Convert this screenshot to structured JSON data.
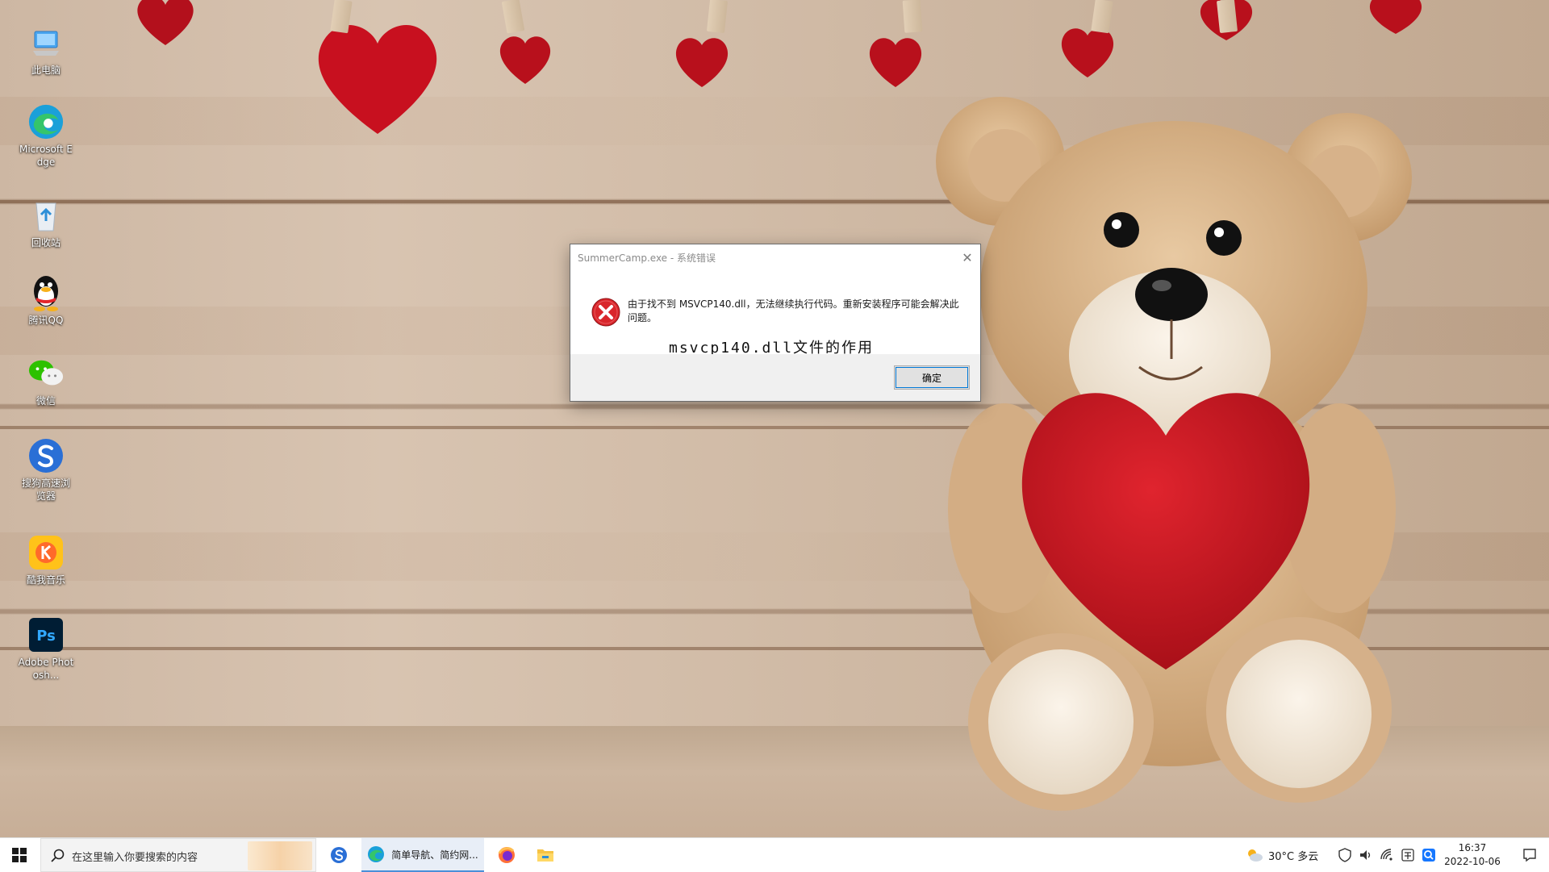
{
  "desktop": {
    "icons": [
      {
        "name": "this-pc",
        "label": "此电脑",
        "icon": "monitor-icon"
      },
      {
        "name": "edge",
        "label": "Microsoft Edge",
        "icon": "edge-icon"
      },
      {
        "name": "recycle-bin",
        "label": "回收站",
        "icon": "recycle-bin-icon"
      },
      {
        "name": "qq",
        "label": "腾讯QQ",
        "icon": "penguin-icon"
      },
      {
        "name": "wechat",
        "label": "微信",
        "icon": "wechat-icon"
      },
      {
        "name": "sogou",
        "label": "搜狗高速浏览器",
        "icon": "sogou-icon"
      },
      {
        "name": "kuwo",
        "label": "酷我音乐",
        "icon": "kuwo-icon"
      },
      {
        "name": "photoshop",
        "label": "Adobe Photosh...",
        "icon": "photoshop-icon"
      }
    ]
  },
  "dialog": {
    "title": "SummerCamp.exe - 系统错误",
    "message": "由于找不到 MSVCP140.dll，无法继续执行代码。重新安装程序可能会解决此问题。",
    "overlay_text": "msvcp140.dll文件的作用",
    "ok_label": "确定",
    "close_glyph": "✕"
  },
  "taskbar": {
    "search_placeholder": "在这里输入你要搜索的内容",
    "active_app_label": "简单导航、简约网...",
    "weather": "30°C  多云",
    "time": "16:37",
    "date": "2022-10-06"
  },
  "colors": {
    "error_red": "#d9262b",
    "accent_blue": "#0078d7"
  }
}
